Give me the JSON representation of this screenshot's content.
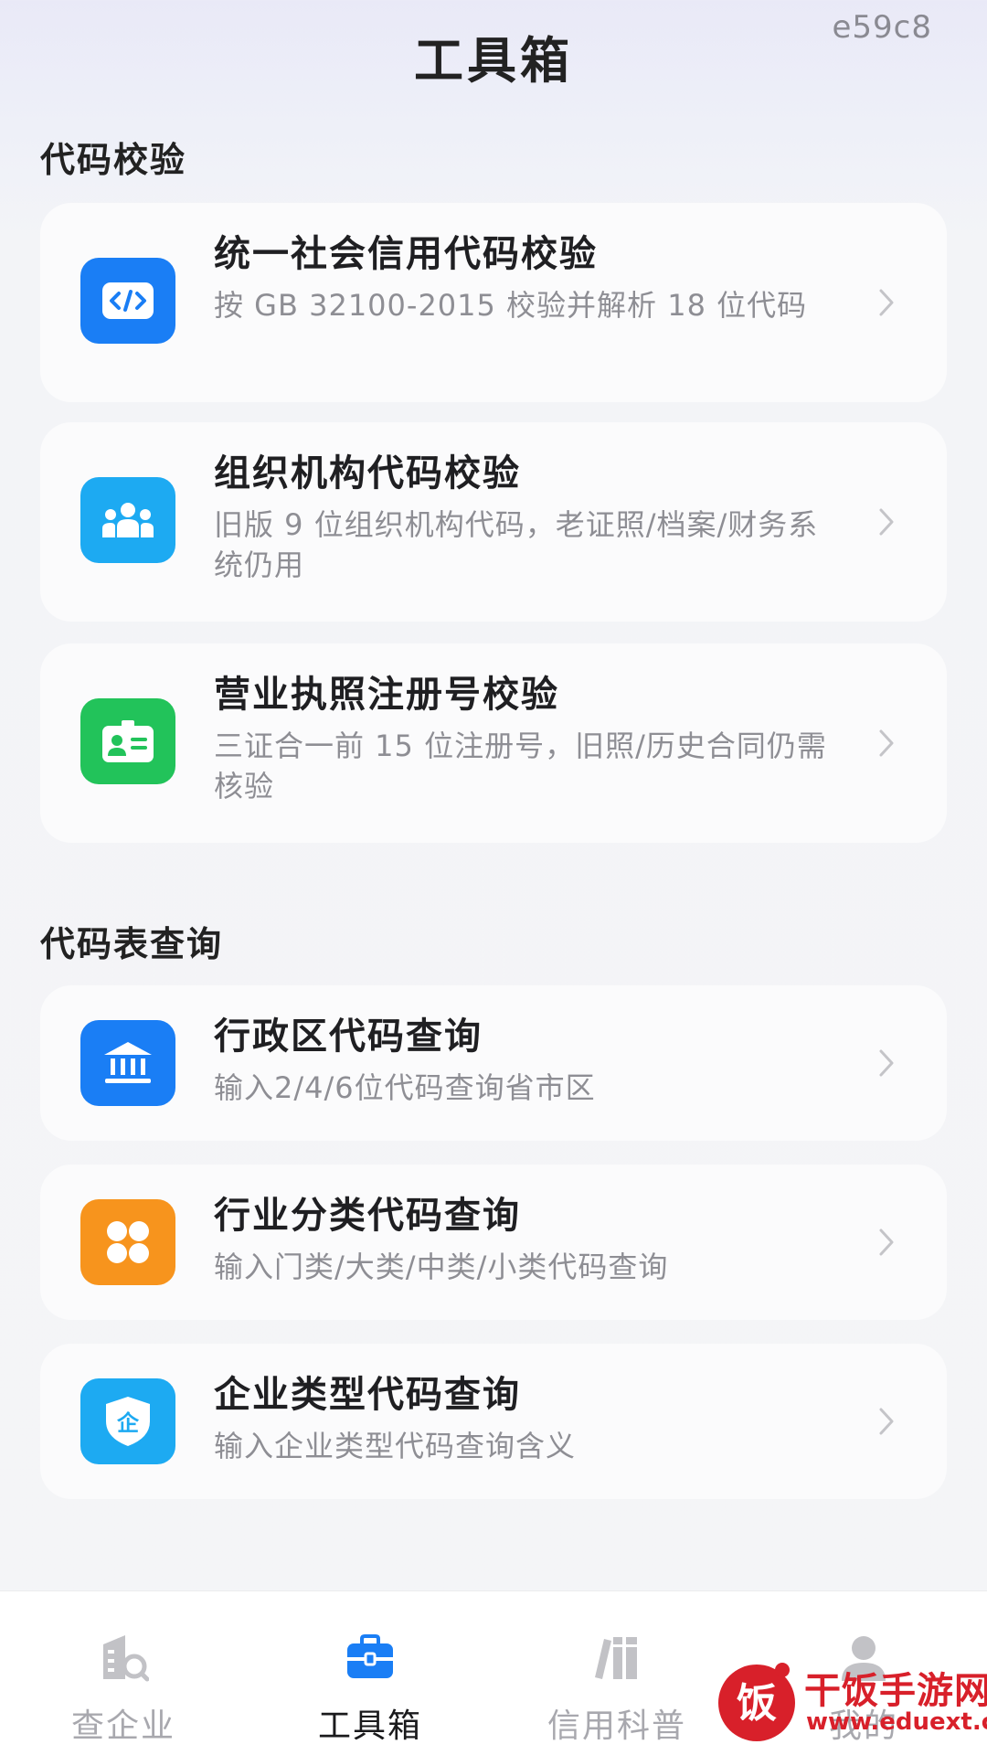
{
  "page_id": "e59c8",
  "page_title": "工具箱",
  "sections": [
    {
      "title": "代码校验",
      "items": [
        {
          "title": "统一社会信用代码校验",
          "desc": "按 GB 32100-2015 校验并解析 18 位代码",
          "icon": "code-icon",
          "color": "#1a7ef5"
        },
        {
          "title": "组织机构代码校验",
          "desc": "旧版 9 位组织机构代码，老证照/档案/财务系统仍用",
          "icon": "group-icon",
          "color": "#1daaf2"
        },
        {
          "title": "营业执照注册号校验",
          "desc": "三证合一前 15 位注册号，旧照/历史合同仍需核验",
          "icon": "id-card-icon",
          "color": "#22c35a"
        }
      ]
    },
    {
      "title": "代码表查询",
      "items": [
        {
          "title": "行政区代码查询",
          "desc": "输入2/4/6位代码查询省市区",
          "icon": "government-icon",
          "color": "#1a7ef5"
        },
        {
          "title": "行业分类代码查询",
          "desc": "输入门类/大类/中类/小类代码查询",
          "icon": "clover-icon",
          "color": "#f7941d"
        },
        {
          "title": "企业类型代码查询",
          "desc": "输入企业类型代码查询含义",
          "icon": "shield-icon",
          "color": "#1daaf2",
          "icon_text": "企"
        }
      ]
    }
  ],
  "tabs": [
    {
      "label": "查企业",
      "icon": "building-search-icon",
      "active": false
    },
    {
      "label": "工具箱",
      "icon": "toolbox-icon",
      "active": true
    },
    {
      "label": "信用科普",
      "icon": "books-icon",
      "active": false
    },
    {
      "label": "我的",
      "icon": "user-icon",
      "active": false
    }
  ],
  "watermark": {
    "logo_char": "饭",
    "name": "干饭手游网",
    "url": "www.eduext.com"
  },
  "colors": {
    "accent": "#1a7ef5",
    "watermark": "#d8202a"
  }
}
